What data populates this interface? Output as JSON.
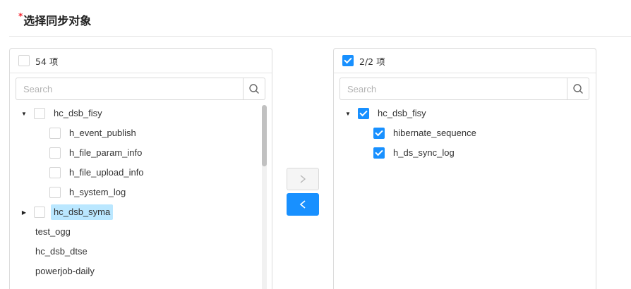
{
  "title": {
    "required_mark": "*",
    "text": "选择同步对象"
  },
  "search_placeholder": "Search",
  "left": {
    "header": "54 项",
    "nodes": [
      {
        "label": "hc_dsb_fisy",
        "expanded": true
      },
      {
        "label": "h_event_publish"
      },
      {
        "label": "h_file_param_info"
      },
      {
        "label": "h_file_upload_info"
      },
      {
        "label": "h_system_log"
      },
      {
        "label": "hc_dsb_syma",
        "expanded": false,
        "highlighted": true
      },
      {
        "label": "test_ogg"
      },
      {
        "label": "hc_dsb_dtse"
      },
      {
        "label": "powerjob-daily"
      }
    ]
  },
  "right": {
    "header": "2/2 项",
    "nodes": [
      {
        "label": "hc_dsb_fisy",
        "expanded": true,
        "checked": true
      },
      {
        "label": "hibernate_sequence",
        "checked": true
      },
      {
        "label": "h_ds_sync_log",
        "checked": true
      }
    ]
  },
  "buttons": {
    "to_right": ">",
    "to_left": "<"
  },
  "colors": {
    "primary": "#1890ff",
    "highlight": "#bae7ff",
    "required": "#f5222d"
  }
}
